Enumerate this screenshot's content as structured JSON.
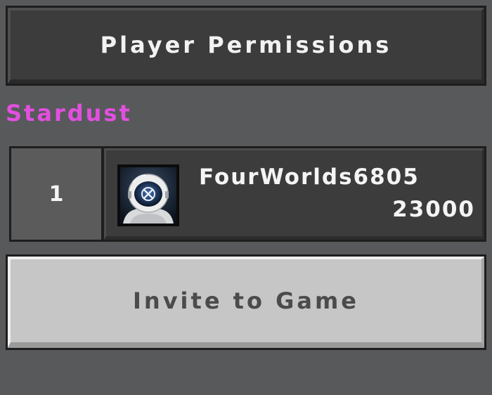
{
  "header": {
    "permissions_label": "Player Permissions"
  },
  "group": {
    "name": "Stardust",
    "color": "#e24fe0"
  },
  "players": [
    {
      "rank": "1",
      "gamertag": "FourWorlds6805",
      "score": "23000",
      "avatar_icon": "astronaut-xbox-avatar-icon"
    }
  ],
  "actions": {
    "invite_label": "Invite to Game"
  }
}
